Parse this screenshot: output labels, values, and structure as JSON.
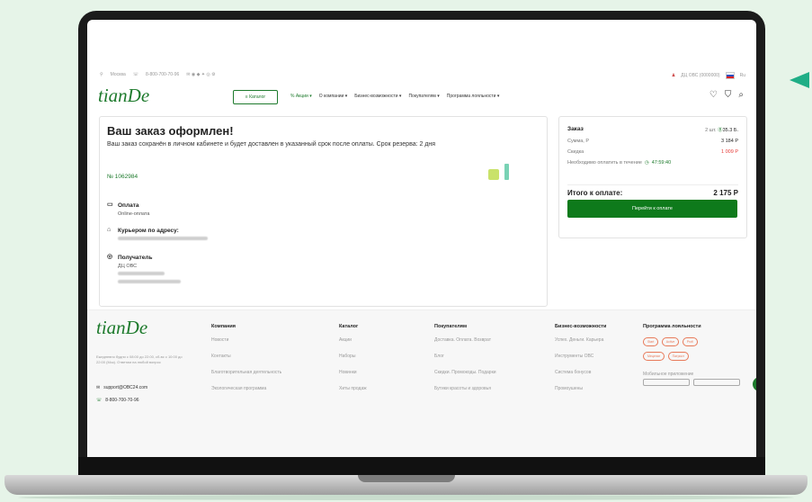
{
  "topbar": {
    "city": "Москва",
    "phone": "8-800-700-70-96",
    "account": "ДЦ ОВС (0000000)",
    "lang": "Ru"
  },
  "header": {
    "logo": "tianDe",
    "catalog_label": "Каталог",
    "nav": [
      "Акции",
      "О компании",
      "Бизнес-возможности",
      "Покупателям",
      "Программа лояльности"
    ],
    "icons": [
      "heart-icon",
      "bag-icon",
      "search-icon"
    ]
  },
  "order": {
    "title": "Ваш заказ оформлен!",
    "subtitle": "Ваш заказ сохранён в личном кабинете и будет доставлен в указанный срок после оплаты. Срок резерва: 2 дня",
    "number": "№ 1062984",
    "payment_label": "Оплата",
    "payment_value": "Online-оплата",
    "delivery_label": "Курьером по адресу:",
    "recipient_label": "Получатель",
    "recipient_value": "ДЦ ОВС"
  },
  "summary": {
    "title": "Заказ",
    "qty": "2 шт.",
    "points": "35.3 Б.",
    "sum_label": "Сумма, Р",
    "sum_value": "3 184 Р",
    "discount_label": "Скидка",
    "discount_value": "1 009 Р",
    "timer_label": "Необходимо оплатить в течение",
    "timer_value": "47:59:40",
    "total_label": "Итого к оплате:",
    "total_value": "2 175 Р",
    "pay_button": "Перейти к оплате",
    "accent": "#0e7a1b",
    "discount_color": "#e53935"
  },
  "footer": {
    "logo": "tianDe",
    "info": "Ежедневно будни с 08:00 до 22:00, сб-вс с 10:00 до 22:00 (Мск). Ответим на любой вопрос",
    "email": "support@OBC24.com",
    "phone": "8-800-700-70-96",
    "columns": [
      {
        "title": "Компания",
        "items": [
          "Новости",
          "Контакты",
          "Благотворительная деятельность",
          "Экологическая программа"
        ]
      },
      {
        "title": "Каталог",
        "items": [
          "Акции",
          "Наборы",
          "Новинки",
          "Хиты продаж"
        ]
      },
      {
        "title": "Покупателям",
        "items": [
          "Доставка. Оплата. Возврат",
          "Блог",
          "Скидки. Промокоды. Подарки",
          "Бутики красоты и здоровья"
        ]
      },
      {
        "title": "Бизнес-возможности",
        "items": [
          "Успех. Деньги. Карьера",
          "Инструменты ОВС",
          "Система бонусов",
          "Промоушены"
        ]
      }
    ],
    "loyalty_title": "Программа лояльности",
    "loyalty_pills": [
      "Start",
      "Active",
      "Profi",
      "Меценат",
      "Патриот"
    ],
    "mobile_label": "Мобильное приложение"
  }
}
